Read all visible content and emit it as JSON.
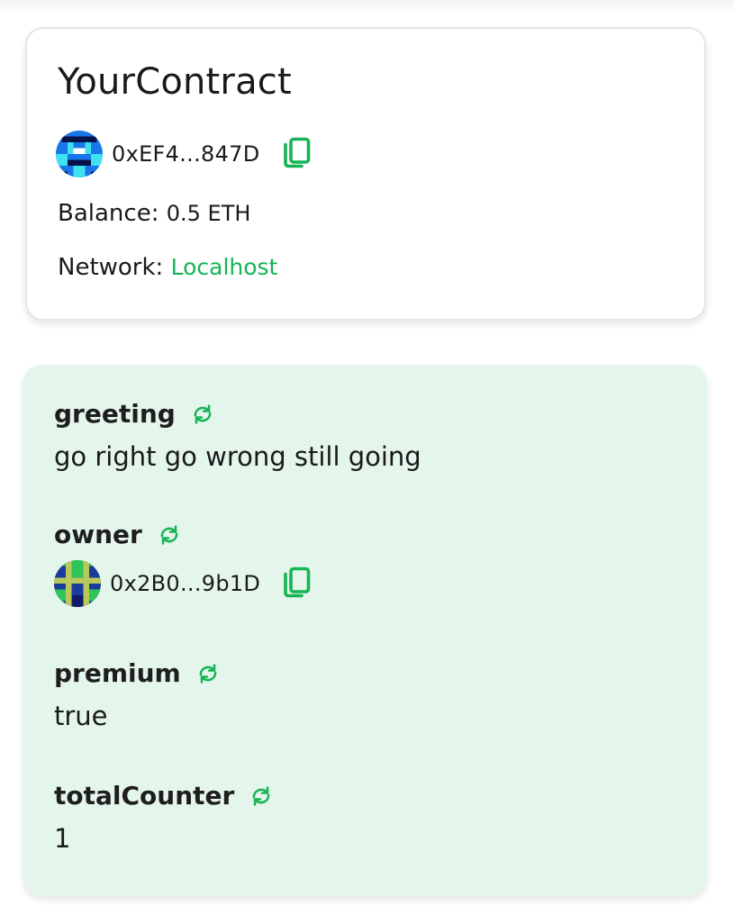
{
  "contract": {
    "title": "YourContract",
    "address_short": "0xEF4...847D",
    "copy_icon": "copy-icon",
    "balance_label": "Balance:",
    "balance_value": "0.5 ETH",
    "network_label": "Network:",
    "network_value": "Localhost",
    "network_color": "#16b455"
  },
  "variables": [
    {
      "name": "greeting",
      "value": "go right go wrong still going",
      "refresh_icon": "refresh-icon"
    },
    {
      "name": "owner",
      "address_short": "0x2B0...9b1D",
      "refresh_icon": "refresh-icon",
      "copy_icon": "copy-icon"
    },
    {
      "name": "premium",
      "value": "true",
      "refresh_icon": "refresh-icon"
    },
    {
      "name": "totalCounter",
      "value": "1",
      "refresh_icon": "refresh-icon"
    }
  ],
  "colors": {
    "accent": "#16b455",
    "panel_background": "#e4f6eb",
    "card_background": "#ffffff"
  }
}
